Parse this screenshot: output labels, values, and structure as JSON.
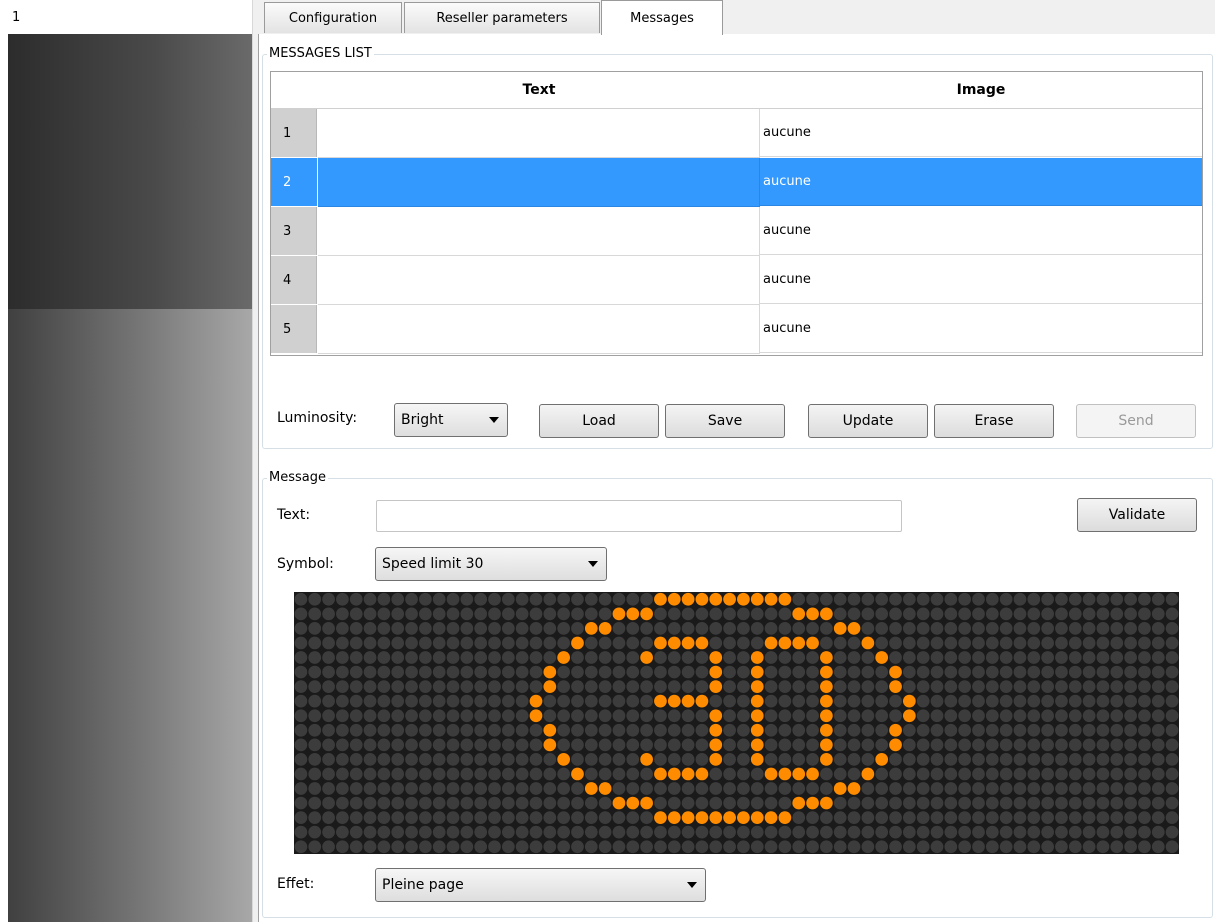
{
  "left_panel": {
    "header": "1"
  },
  "tabs": [
    {
      "label": "Configuration",
      "active": false
    },
    {
      "label": "Reseller parameters",
      "active": false
    },
    {
      "label": "Messages",
      "active": true
    }
  ],
  "messages_list": {
    "title": "MESSAGES LIST",
    "columns": [
      "Text",
      "Image"
    ],
    "rows": [
      {
        "num": "1",
        "text": "",
        "image": "aucune",
        "selected": false
      },
      {
        "num": "2",
        "text": "",
        "image": "aucune",
        "selected": true
      },
      {
        "num": "3",
        "text": "",
        "image": "aucune",
        "selected": false
      },
      {
        "num": "4",
        "text": "",
        "image": "aucune",
        "selected": false
      },
      {
        "num": "5",
        "text": "",
        "image": "aucune",
        "selected": false
      }
    ],
    "luminosity_label": "Luminosity:",
    "luminosity_value": "Bright",
    "buttons": {
      "load": "Load",
      "save": "Save",
      "update": "Update",
      "erase": "Erase",
      "send": "Send"
    }
  },
  "message": {
    "title": "Message",
    "text_label": "Text:",
    "text_value": "",
    "validate": "Validate",
    "symbol_label": "Symbol:",
    "symbol_value": "Speed limit 30",
    "effect_label": "Effet:",
    "effect_value": "Pleine page"
  },
  "led_display": {
    "columns": 64,
    "rows": 18,
    "on_color": "#ff8c00",
    "off_color": "#3c3c3c",
    "background": "#1a1a1a",
    "pattern": [
      "0000000000000000000000000011111111110000000000000000000000000000",
      "0000000000000000000000011100000000001110000000000000000000000000",
      "0000000000000000000001100000000000000001100000000000000000000000",
      "0000000000000000000010000011110000111100010000000000000000000000",
      "0000000000000000000100000100001001000010001000000000000000000000",
      "0000000000000000001000000000001001000010000100000000000000000000",
      "0000000000000000001000000000001001000010000100000000000000000000",
      "0000000000000000010000000011110001000010000010000000000000000000",
      "0000000000000000010000000000001001000010000010000000000000000000",
      "0000000000000000001000000000001001000010000100000000000000000000",
      "0000000000000000001000000000001001000010000100000000000000000000",
      "0000000000000000000100000100001001000010001000000000000000000000",
      "0000000000000000000010000011110000111100010000000000000000000000",
      "0000000000000000000001100000000000000001100000000000000000000000",
      "0000000000000000000000011100000000001110000000000000000000000000",
      "0000000000000000000000000011111111110000000000000000000000000000",
      "0000000000000000000000000000000000000000000000000000000000000000",
      "0000000000000000000000000000000000000000000000000000000000000000"
    ]
  }
}
